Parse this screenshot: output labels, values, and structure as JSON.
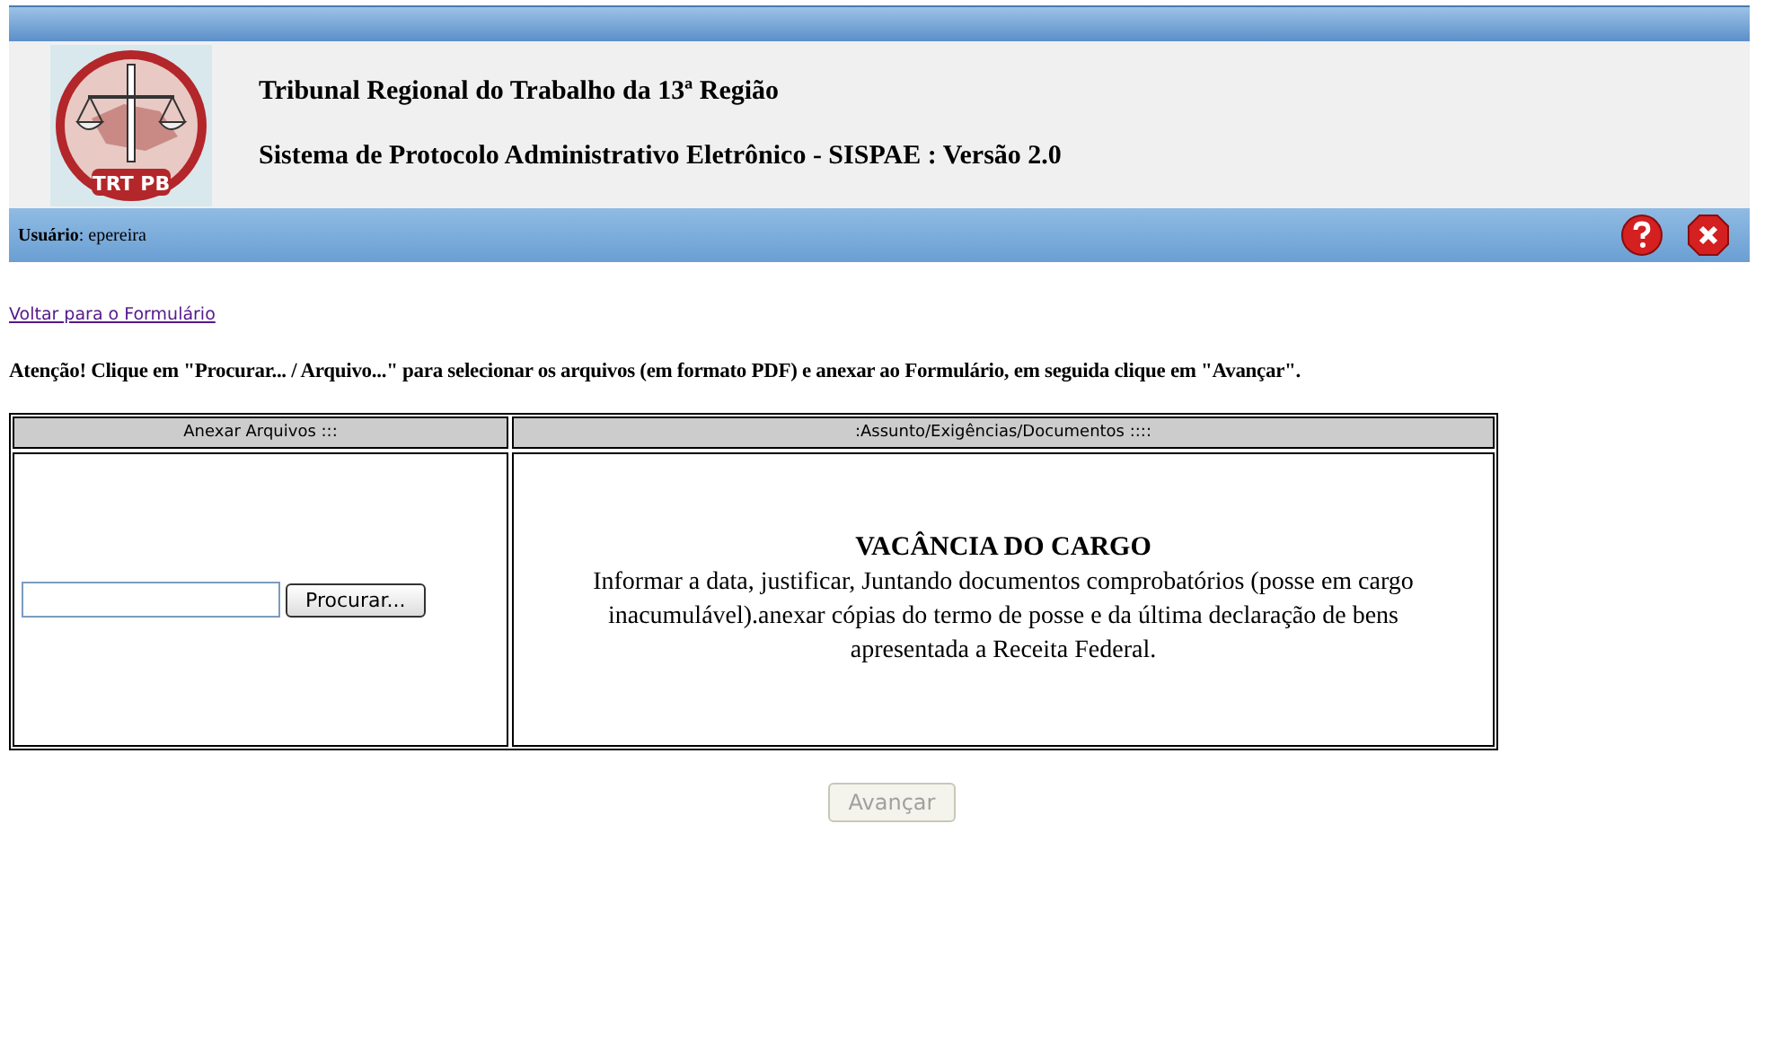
{
  "header": {
    "title": "Tribunal Regional do Trabalho da 13ª Região",
    "subtitle": "Sistema de Protocolo Administrativo Eletrônico - SISPAE : Versão 2.0",
    "logo_text": "TRT PB"
  },
  "user_bar": {
    "label": "Usuário",
    "value": ": epereira"
  },
  "back_link": "Voltar para o Formulário",
  "notice": "Atenção! Clique em \"Procurar... / Arquivo...\" para selecionar os arquivos (em formato PDF) e anexar ao Formulário, em seguida clique em \"Avançar\".",
  "table": {
    "columns": [
      "Anexar Arquivos :::",
      ":Assunto/Exigências/Documentos ::::"
    ],
    "browse_button": "Procurar...",
    "subject_title": "VACÂNCIA DO CARGO",
    "subject_text": "Informar a data, justificar, Juntando documentos comprobatórios (posse em cargo inacumulável).anexar cópias do termo de posse e da última declaração de bens apresentada a Receita Federal."
  },
  "next_button": {
    "label": "Avançar",
    "disabled": true
  }
}
